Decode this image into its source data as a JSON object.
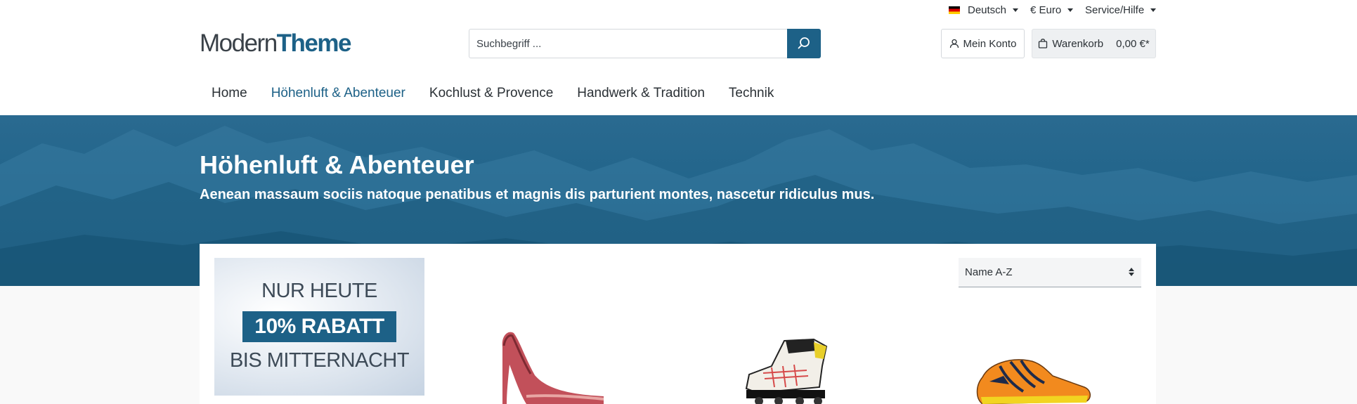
{
  "topbar": {
    "language": "Deutsch",
    "currency": "€ Euro",
    "service": "Service/Hilfe"
  },
  "header": {
    "logo_part1": "Modern",
    "logo_part2": "Theme",
    "search_placeholder": "Suchbegriff ...",
    "account_label": "Mein Konto",
    "cart_label": "Warenkorb",
    "cart_price": "0,00 €*"
  },
  "nav": {
    "items": [
      {
        "label": "Home"
      },
      {
        "label": "Höhenluft & Abenteuer"
      },
      {
        "label": "Kochlust & Provence"
      },
      {
        "label": "Handwerk & Tradition"
      },
      {
        "label": "Technik"
      }
    ]
  },
  "hero": {
    "title": "Höhenluft & Abenteuer",
    "subtitle": "Aenean massaum sociis natoque penatibus et magnis dis parturient montes, nascetur ridiculus mus."
  },
  "promo": {
    "line1": "NUR HEUTE",
    "highlight": "10% RABATT",
    "line3": "BIS MITTERNACHT"
  },
  "sort": {
    "selected": "Name A-Z"
  },
  "colors": {
    "brand": "#1d6187",
    "text": "#2b3136"
  }
}
